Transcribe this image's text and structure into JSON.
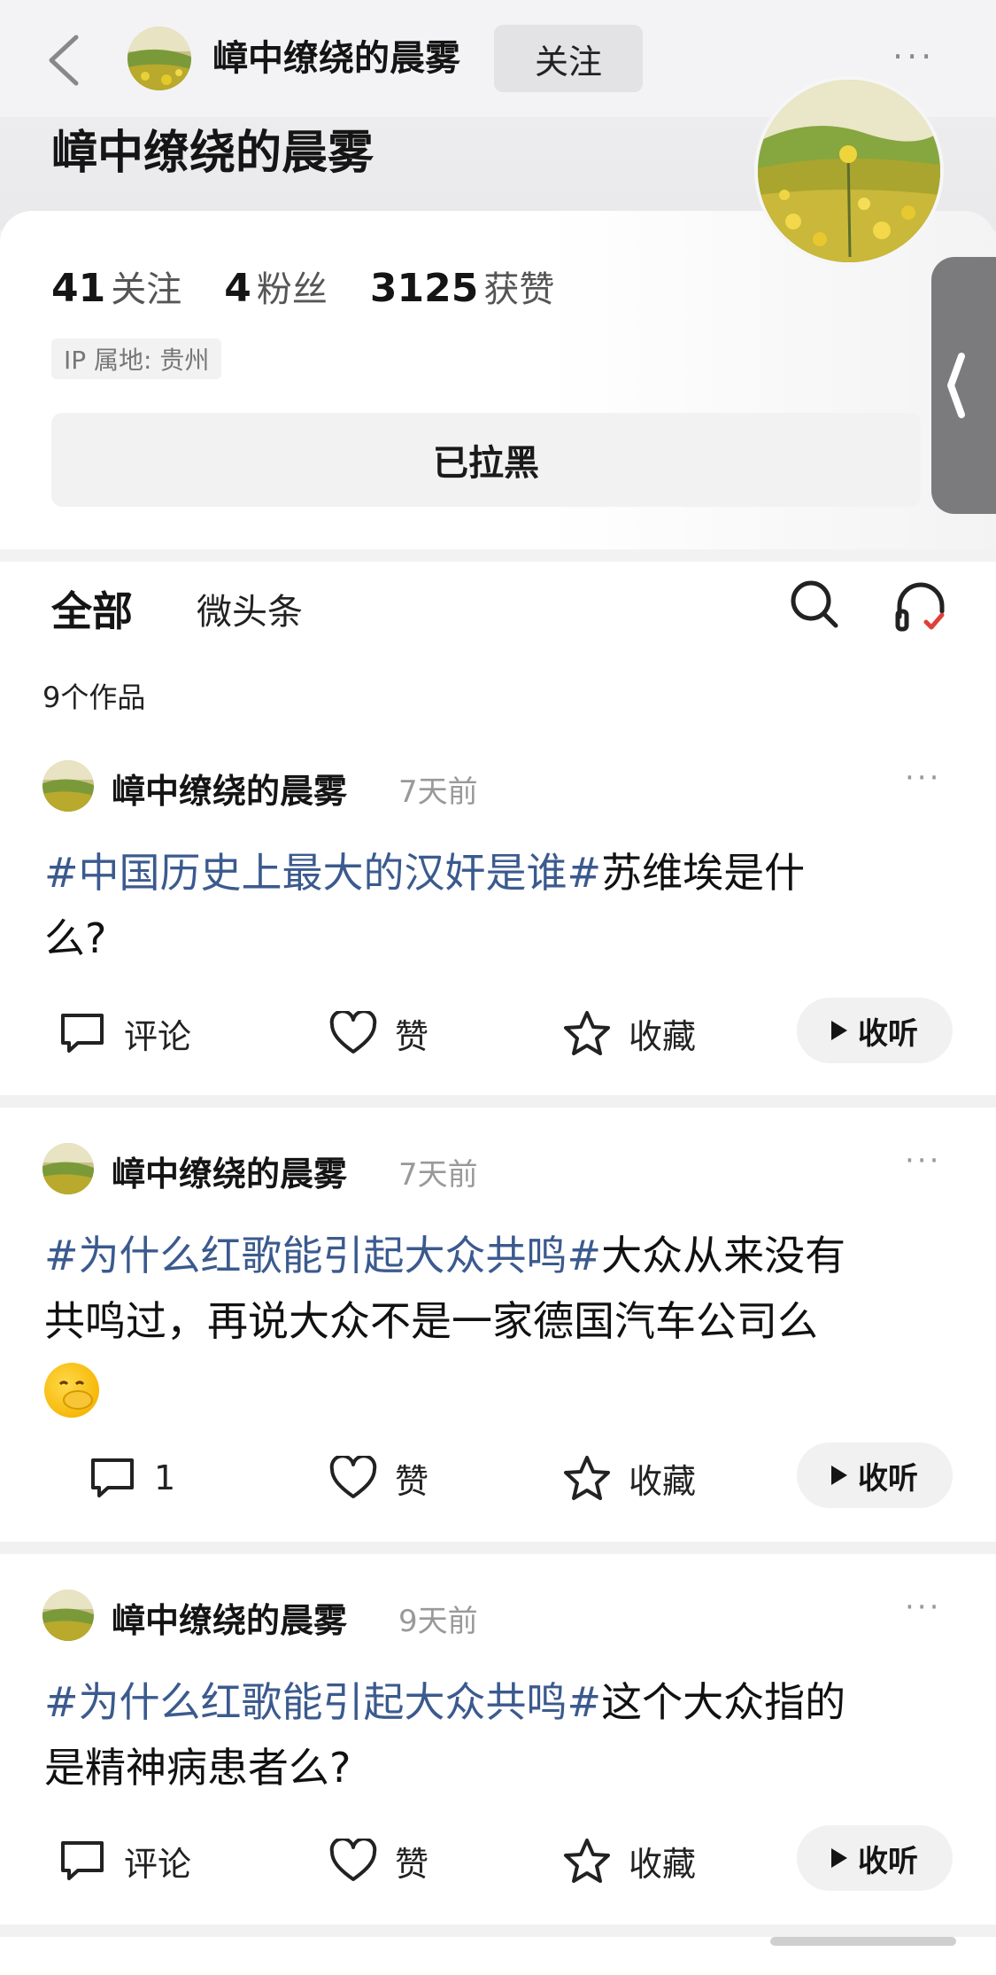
{
  "header": {
    "title": "嶂中缭绕的晨雾",
    "follow_label": "关注",
    "more_label": "···"
  },
  "profile": {
    "name": "嶂中缭绕的晨雾",
    "stats": [
      {
        "num": "41",
        "label": "关注"
      },
      {
        "num": "4",
        "label": "粉丝"
      },
      {
        "num": "3125",
        "label": "获赞"
      }
    ],
    "ip": "IP 属地: 贵州",
    "blocked_label": "已拉黑"
  },
  "tabs": {
    "all": "全部",
    "weitoutiao": "微头条"
  },
  "works_count": "9个作品",
  "posts": [
    {
      "author": "嶂中缭绕的晨雾",
      "time": "7天前",
      "tag": "#中国历史上最大的汉奸是谁#",
      "text_line1": "苏维埃是什",
      "text_line2": "么?",
      "comment": "评论",
      "like": "赞",
      "fav": "收藏",
      "listen": "收听"
    },
    {
      "author": "嶂中缭绕的晨雾",
      "time": "7天前",
      "tag": "#为什么红歌能引起大众共鸣#",
      "text_line1": "大众从来没有",
      "text_line2": "共鸣过，再说大众不是一家德国汽车公司么",
      "comment": "1",
      "like": "赞",
      "fav": "收藏",
      "listen": "收听"
    },
    {
      "author": "嶂中缭绕的晨雾",
      "time": "9天前",
      "tag": "#为什么红歌能引起大众共鸣#",
      "text_line1": "这个大众指的",
      "text_line2": "是精神病患者么?",
      "comment": "评论",
      "like": "赞",
      "fav": "收藏",
      "listen": "收听"
    }
  ],
  "colors": {
    "hashtag": "#3b5a8e",
    "handle": "#7b7b7e"
  }
}
